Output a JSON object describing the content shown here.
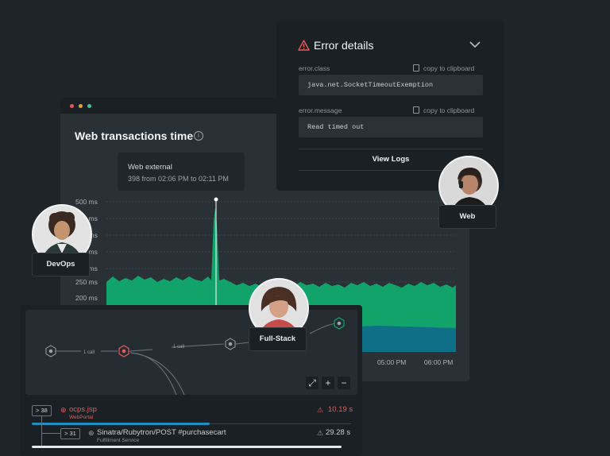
{
  "transactions": {
    "title": "Web transactions time",
    "tooltip": {
      "title": "Web external",
      "detail": "398 from 02:06 PM to 02:11 PM"
    },
    "y_labels": [
      "500 ms",
      "450 ms",
      "400 ms",
      "350 ms",
      "300 ms",
      "250 ms",
      "200 ms"
    ],
    "x_labels": [
      "05:00 PM",
      "06:00 PM"
    ],
    "colors": {
      "green": "#12a36a",
      "teal": "#0e6f86",
      "grid": "#3b4348"
    }
  },
  "error": {
    "title": "Error details",
    "class_label": "error.class",
    "class_value": "java.net.SocketTimeoutExemption",
    "message_label": "error.message",
    "message_value": "Read timed out",
    "copy_label": "copy to clipboard",
    "view_logs": "View Logs",
    "accent": "#e55a57"
  },
  "personas": {
    "devops": "DevOps",
    "web": "Web",
    "fullstack": "Full-Stack"
  },
  "service_map": {
    "edge_label_1": "1 call",
    "edge_label_2": "1 call",
    "rows": [
      {
        "count": "> 38",
        "name": "ocps.jsp",
        "sub": "WebPortal",
        "time": "10.19 s"
      },
      {
        "count": "> 31",
        "name": "Sinatra/Rubytron/POST #purchasecart",
        "sub": "Fulfillment Service",
        "time": "29.28 s"
      }
    ],
    "controls": [
      "expand-icon",
      "plus-icon",
      "minus-icon"
    ]
  }
}
